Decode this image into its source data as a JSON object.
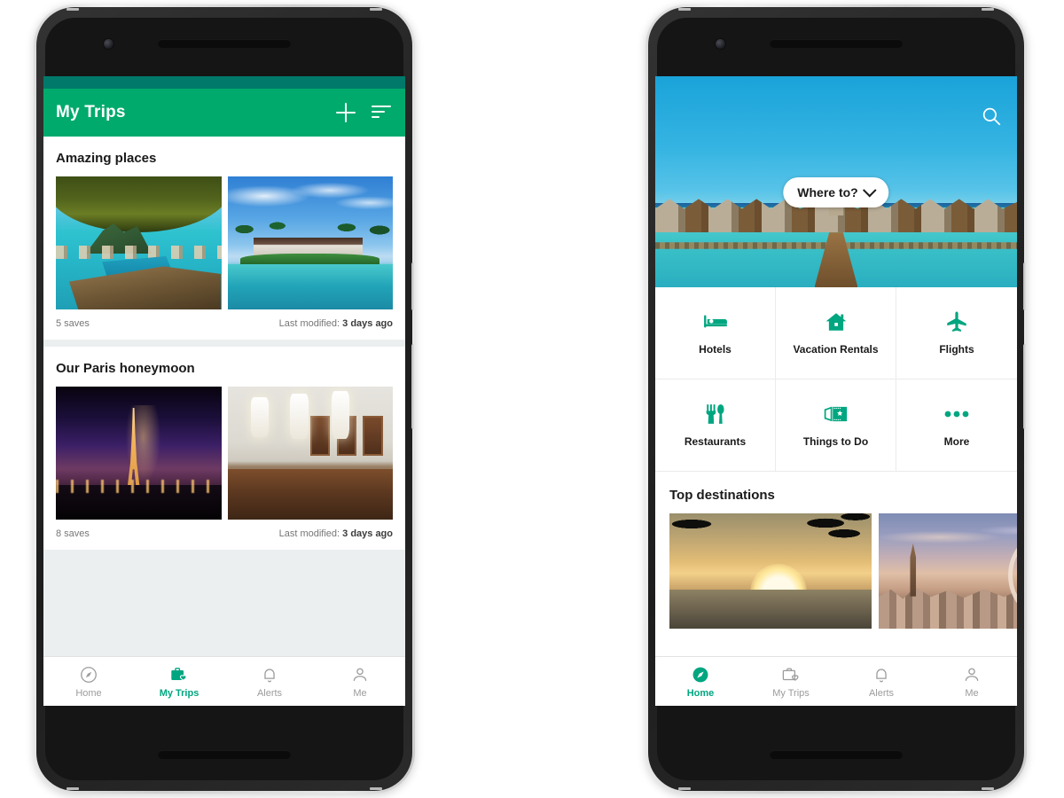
{
  "colors": {
    "brand_green": "#00aa6c",
    "statusbar_green": "#00796b",
    "active_green": "#00a680",
    "inactive_gray": "#9b9b9b",
    "card_bg": "#ffffff",
    "page_bg": "#eceff0"
  },
  "phone_left": {
    "screen_name": "my-trips",
    "appbar": {
      "title": "My Trips",
      "add_icon": "plus-icon",
      "sort_icon": "sort-icon"
    },
    "trips": [
      {
        "title": "Amazing places",
        "saves": "5 saves",
        "modified_label": "Last modified:",
        "modified_value": "3 days ago",
        "photos": [
          "overwater-bungalow-view",
          "resort-pool-palms"
        ]
      },
      {
        "title": "Our Paris honeymoon",
        "saves": "8 saves",
        "modified_label": "Last modified:",
        "modified_value": "3 days ago",
        "photos": [
          "eiffel-tower-night",
          "hotel-lobby-reception"
        ]
      }
    ],
    "bottom_nav": {
      "active": "My Trips",
      "items": [
        {
          "label": "Home",
          "icon": "compass-icon",
          "active": false
        },
        {
          "label": "My Trips",
          "icon": "briefcase-heart-icon",
          "active": true
        },
        {
          "label": "Alerts",
          "icon": "bell-icon",
          "active": false
        },
        {
          "label": "Me",
          "icon": "person-icon",
          "active": false
        }
      ]
    }
  },
  "phone_right": {
    "screen_name": "home",
    "hero": {
      "image": "maldives-overwater-bungalows",
      "search_icon": "search-icon",
      "where_to_label": "Where to?",
      "where_to_chevron": "chevron-down-icon"
    },
    "categories": [
      {
        "label": "Hotels",
        "icon": "bed-icon"
      },
      {
        "label": "Vacation Rentals",
        "icon": "house-icon"
      },
      {
        "label": "Flights",
        "icon": "airplane-icon"
      },
      {
        "label": "Restaurants",
        "icon": "fork-knife-icon"
      },
      {
        "label": "Things to Do",
        "icon": "tickets-icon"
      },
      {
        "label": "More",
        "icon": "more-dots-icon"
      }
    ],
    "top_destinations": {
      "title": "Top destinations",
      "items": [
        "beach-sunset-palms",
        "london-skyline-dusk"
      ]
    },
    "bottom_nav": {
      "active": "Home",
      "items": [
        {
          "label": "Home",
          "icon": "compass-filled-icon",
          "active": true
        },
        {
          "label": "My Trips",
          "icon": "briefcase-heart-icon",
          "active": false
        },
        {
          "label": "Alerts",
          "icon": "bell-icon",
          "active": false
        },
        {
          "label": "Me",
          "icon": "person-icon",
          "active": false
        }
      ]
    }
  }
}
